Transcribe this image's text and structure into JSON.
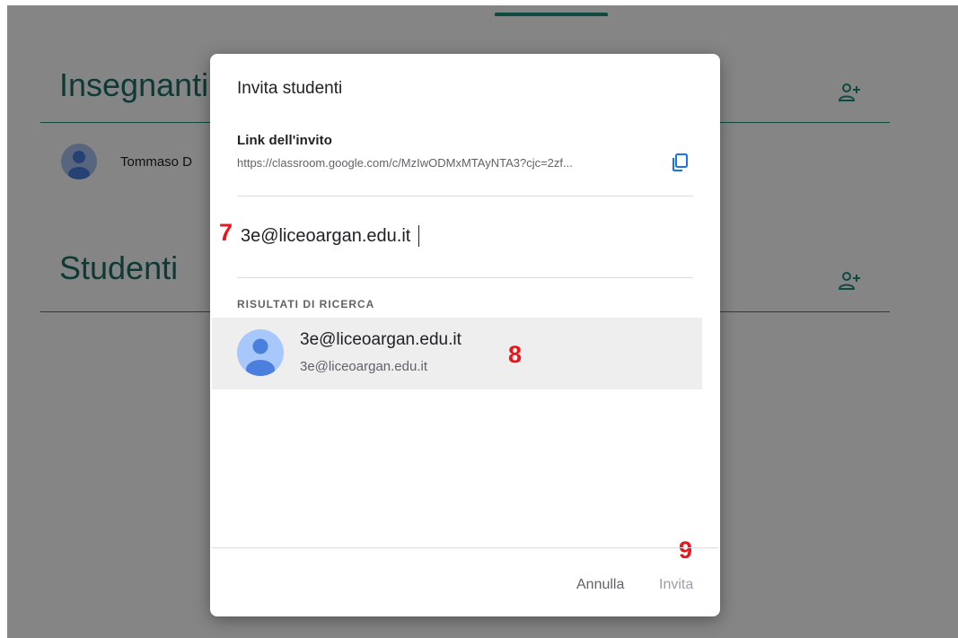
{
  "background": {
    "teachers_title": "Insegnanti",
    "students_title": "Studenti",
    "teacher_name": "Tommaso D"
  },
  "dialog": {
    "title": "Invita studenti",
    "link_label": "Link dell'invito",
    "link_url": "https://classroom.google.com/c/MzIwODMxMTAyNTA3?cjc=2zf...",
    "search_value": "3e@liceoargan.edu.it",
    "results_label": "RISULTATI DI RICERCA",
    "result": {
      "name": "3e@liceoargan.edu.it",
      "email": "3e@liceoargan.edu.it"
    },
    "cancel_label": "Annulla",
    "invite_label": "Invita"
  },
  "annotations": {
    "step_7": "7",
    "step_8": "8",
    "step_9": "9"
  },
  "icons": {
    "copy": "copy-icon",
    "add_person": "person-add-icon",
    "avatar": "account-avatar-icon"
  },
  "colors": {
    "accent": "#1e8e7e",
    "annotation": "#e8171b",
    "avatar": "#a8c7fa",
    "avatar_figure": "#4a7fde"
  }
}
